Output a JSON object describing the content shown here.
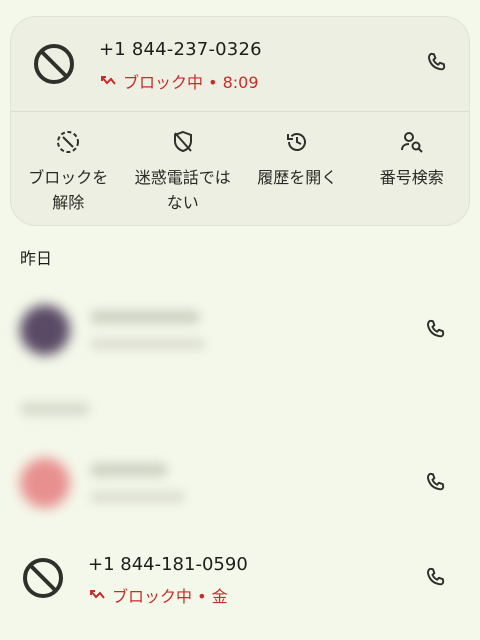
{
  "expanded_call": {
    "number": "+1 844-237-0326",
    "status": "ブロック中 • 8:09",
    "actions": [
      {
        "label": "ブロックを\n解除",
        "icon": "unblock-icon"
      },
      {
        "label": "迷惑電話では\nない",
        "icon": "not-spam-icon"
      },
      {
        "label": "履歴を開く",
        "icon": "history-icon"
      },
      {
        "label": "番号検索",
        "icon": "person-search-icon"
      }
    ]
  },
  "section_yesterday": "昨日",
  "blocked_call_2": {
    "number": "+1 844-181-0590",
    "status": "ブロック中 • 金"
  },
  "colors": {
    "background": "#f4f8ea",
    "card": "#ecefe1",
    "blocked_red": "#c62d2b",
    "icon": "#2f302b"
  }
}
